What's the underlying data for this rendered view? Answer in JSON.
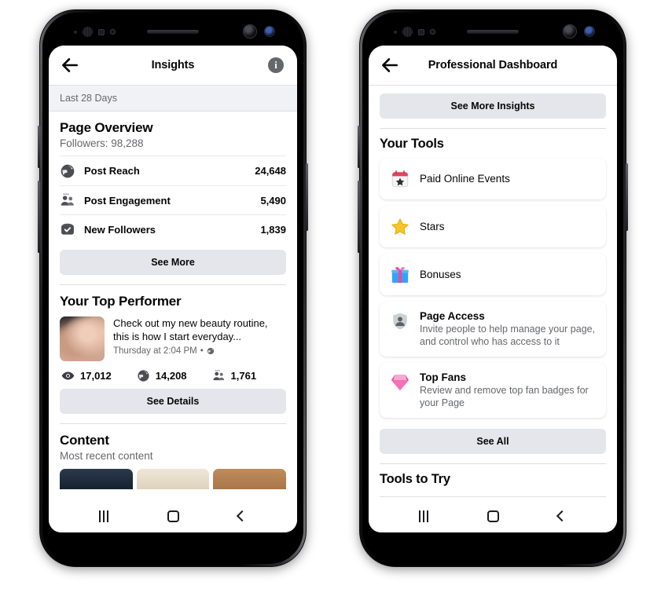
{
  "left_phone": {
    "appbar": {
      "title": "Insights",
      "back_icon": "arrow-left-icon",
      "info_icon": "info-icon"
    },
    "date_range": "Last 28 Days",
    "page_overview": {
      "heading": "Page Overview",
      "followers": "Followers: 98,288",
      "metrics": [
        {
          "icon": "globe-icon",
          "label": "Post Reach",
          "value": "24,648"
        },
        {
          "icon": "people-icon",
          "label": "Post Engagement",
          "value": "5,490"
        },
        {
          "icon": "check-badge-icon",
          "label": "New Followers",
          "value": "1,839"
        }
      ],
      "see_more": "See More"
    },
    "top_performer": {
      "heading": "Your Top Performer",
      "post_text": "Check out my new beauty routine, this is how I start everyday...",
      "post_meta": "Thursday at 2:04 PM",
      "post_privacy_icon": "globe-icon",
      "stats": [
        {
          "icon": "eye-icon",
          "value": "17,012"
        },
        {
          "icon": "globe-icon",
          "value": "14,208"
        },
        {
          "icon": "people-icon",
          "value": "1,761"
        }
      ],
      "see_details": "See Details"
    },
    "content": {
      "heading": "Content",
      "subtitle": "Most recent content"
    }
  },
  "right_phone": {
    "appbar": {
      "title": "Professional Dashboard",
      "back_icon": "arrow-left-icon"
    },
    "see_more_insights": "See More Insights",
    "your_tools": {
      "heading": "Your Tools",
      "items": [
        {
          "icon": "calendar-star-icon",
          "title": "Paid Online Events",
          "desc": ""
        },
        {
          "icon": "star-icon",
          "title": "Stars",
          "desc": ""
        },
        {
          "icon": "gift-icon",
          "title": "Bonuses",
          "desc": ""
        },
        {
          "icon": "shield-person-icon",
          "title": "Page Access",
          "desc": "Invite people to help manage your page, and control who has access to it"
        },
        {
          "icon": "gem-icon",
          "title": "Top Fans",
          "desc": "Review and remove top fan badges for your Page"
        }
      ],
      "see_all": "See All"
    },
    "tools_to_try": {
      "heading": "Tools to Try"
    }
  },
  "navbar": {
    "recents": "recents-button",
    "home": "home-button",
    "back": "back-button"
  },
  "colors": {
    "accent_gray": "#e4e6eb",
    "band": "#f0f2f5",
    "text": "#050505",
    "muted": "#65676b"
  }
}
